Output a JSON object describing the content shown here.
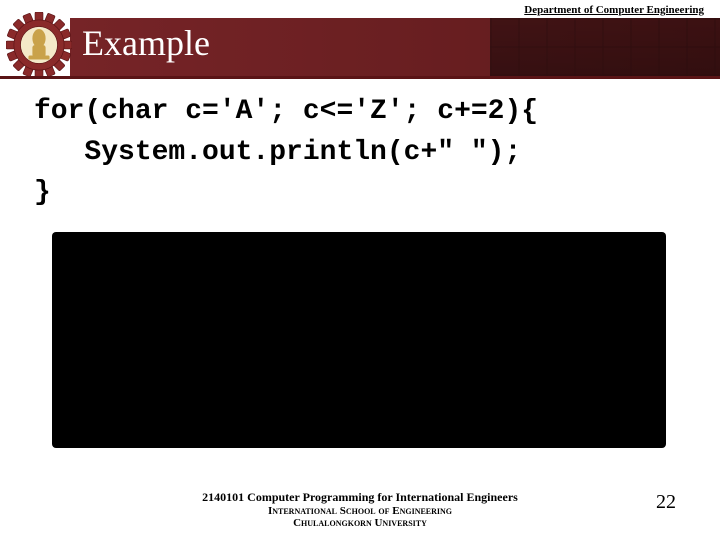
{
  "header": {
    "department": "Department of Computer Engineering",
    "title": "Example"
  },
  "code": {
    "line1": "for(char c='A'; c<='Z'; c+=2){",
    "line2": "   System.out.println(c+\" \");",
    "line3": "}"
  },
  "footer": {
    "course": "2140101 Computer Programming for International Engineers",
    "school": "International School of Engineering",
    "university": "Chulalongkorn University",
    "page": "22"
  }
}
